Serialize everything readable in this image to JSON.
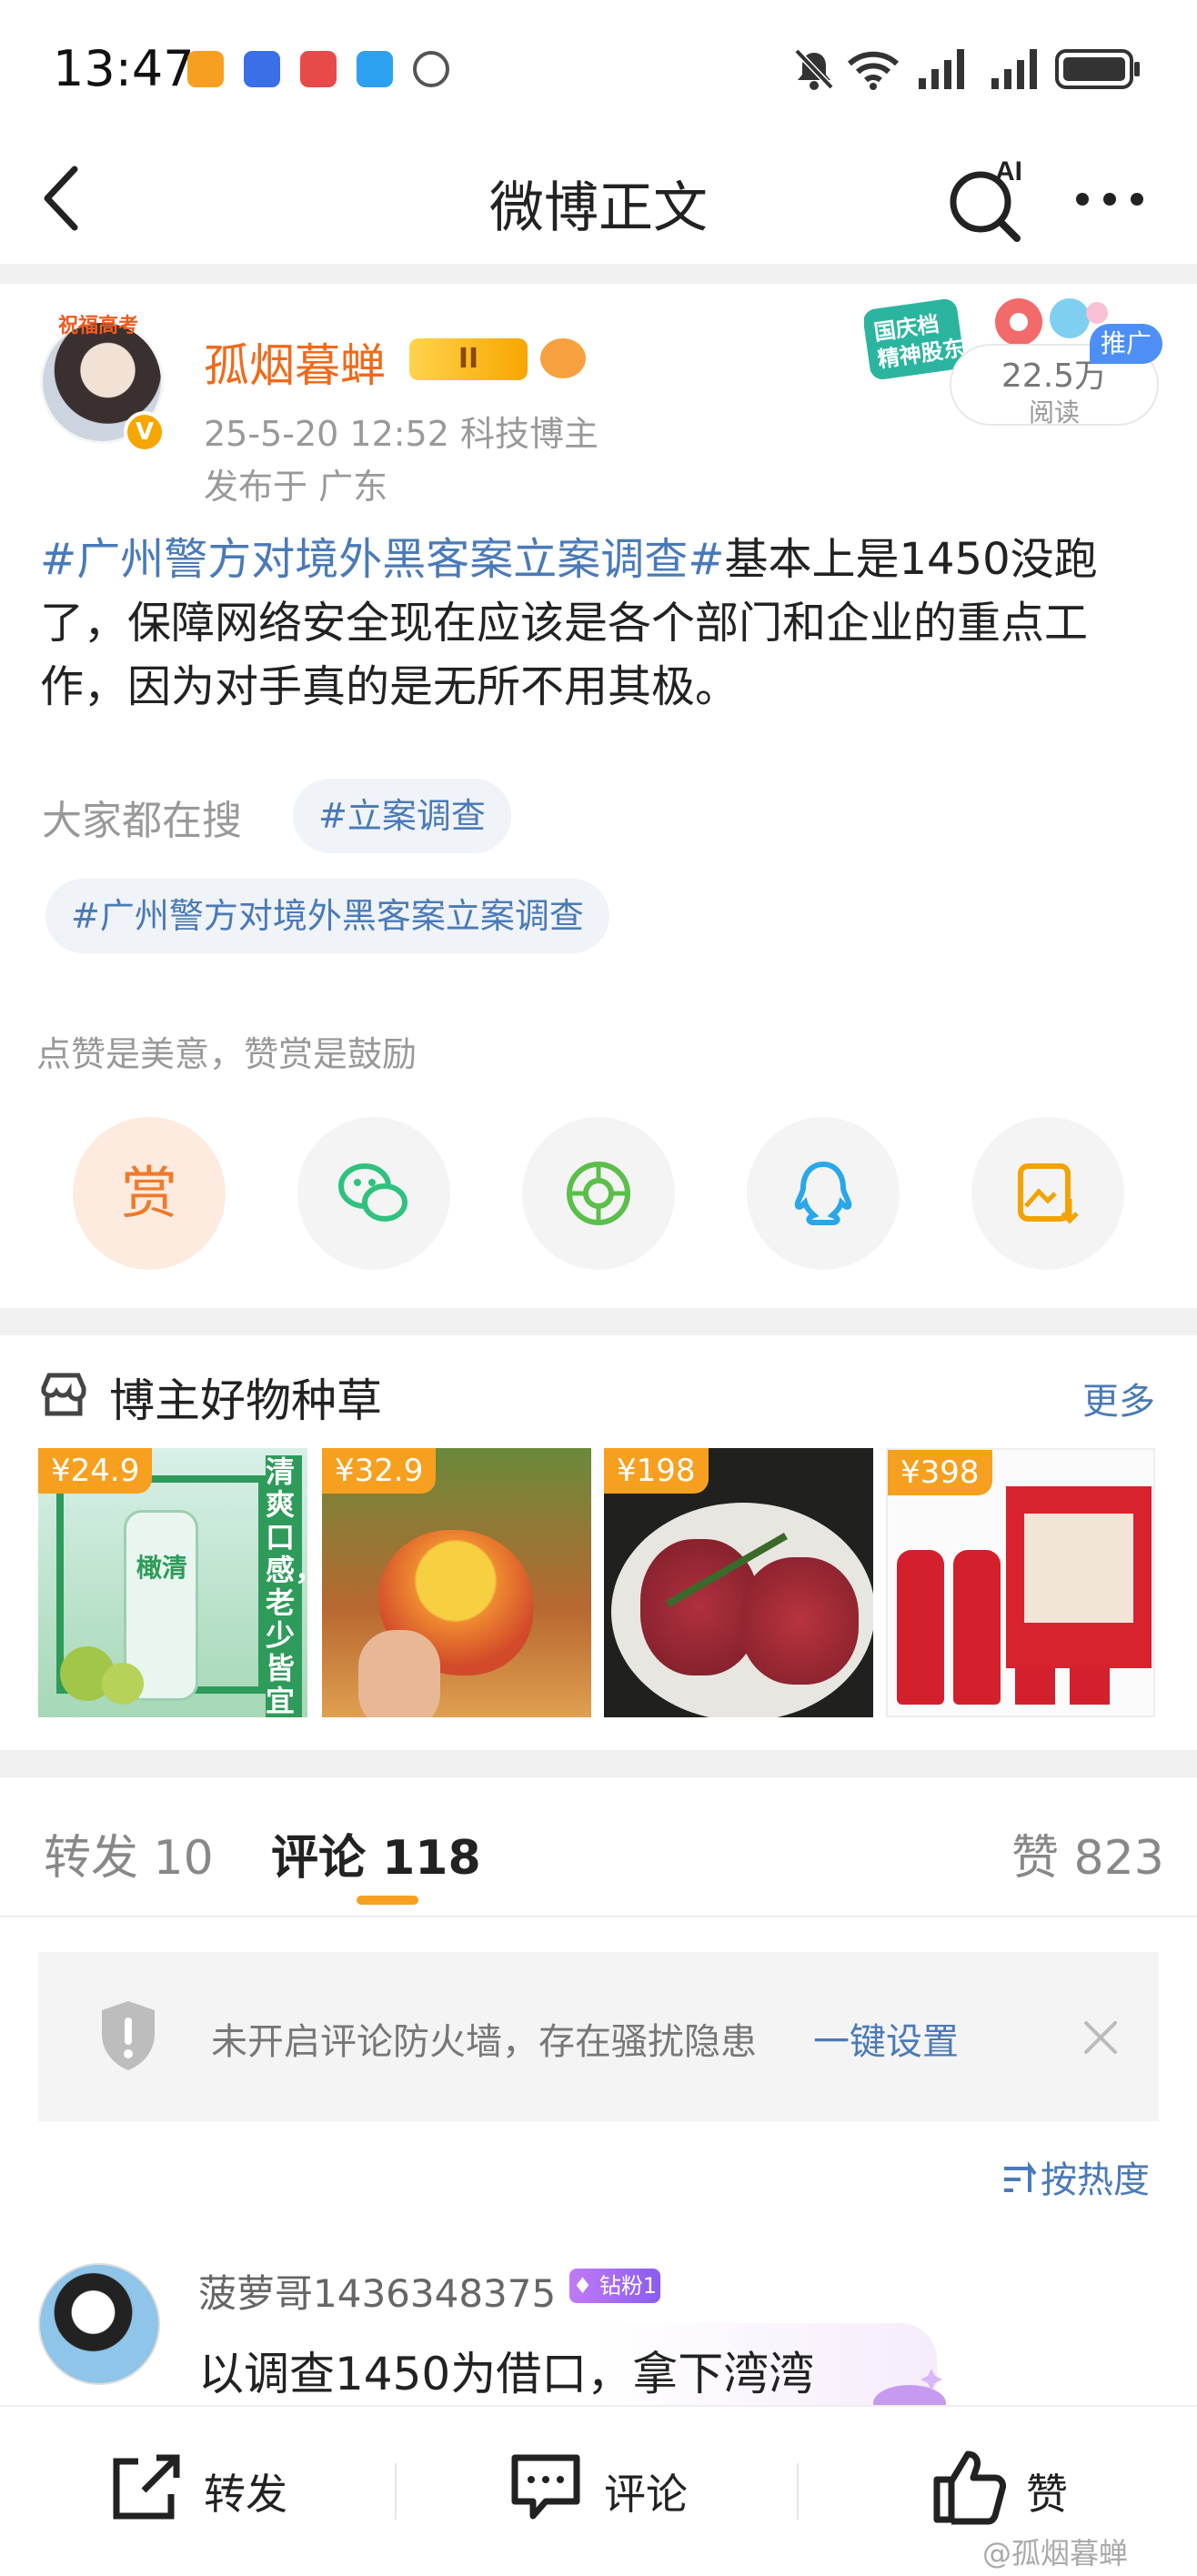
{
  "status_bar": {
    "time": "13:47"
  },
  "nav": {
    "title": "微博正文",
    "ai_label": "AI"
  },
  "post": {
    "avatar_ribbon": "祝福高考",
    "username": "孤烟暮蝉",
    "level": "II",
    "time_and_tag": "25-5-20 12:52   科技博主",
    "location": "发布于 广东",
    "reads_count": "22.5万",
    "reads_label": "阅读",
    "promo_tag": "推广",
    "promo_art_text": "国庆档 精神股东",
    "hashtag": "#广州警方对境外黑客案立案调查#",
    "body": "基本上是1450没跑了，保障网络安全现在应该是各个部门和企业的重点工作，因为对手真的是无所不用其极。"
  },
  "search": {
    "label": "大家都在搜",
    "chips": [
      "#立案调查",
      "#广州警方对境外黑客案立案调查"
    ]
  },
  "praise": {
    "text": "点赞是美意，赞赏是鼓励",
    "reward_label": "赏"
  },
  "share_icons": [
    "reward-icon",
    "wechat-icon",
    "moments-icon",
    "qq-icon",
    "save-image-icon"
  ],
  "goods": {
    "title": "博主好物种草",
    "more": "更多",
    "items": [
      {
        "price": "¥24.9",
        "art_text": "清爽口感，老少皆宜",
        "bottle_text": "橄清"
      },
      {
        "price": "¥32.9"
      },
      {
        "price": "¥198"
      },
      {
        "price": "¥398"
      }
    ]
  },
  "tabs": {
    "repost": "转发 10",
    "comments": "评论 118",
    "likes": "赞 823"
  },
  "firewall": {
    "text": "未开启评论防火墙，存在骚扰隐患",
    "link": "一键设置"
  },
  "sort": {
    "label": "按热度"
  },
  "comment": {
    "user": "菠萝哥1436348375",
    "fan_badge": "钻粉1",
    "text": "以调查1450为借口，拿下湾湾"
  },
  "bottom_bar": {
    "repost": "转发",
    "comment": "评论",
    "like": "赞"
  },
  "watermark": "@孤烟暮蝉",
  "colors": {
    "accent_orange": "#f7a020",
    "link_blue": "#4a7ab8",
    "username_orange": "#f06a1a"
  }
}
